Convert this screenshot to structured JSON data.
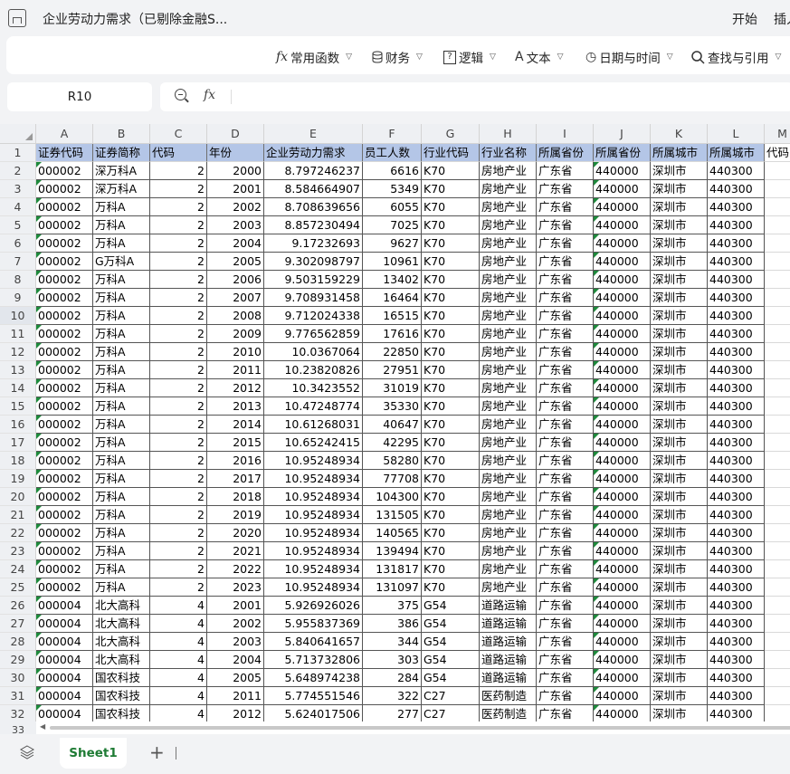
{
  "titlebar": {
    "doc_title": "企业劳动力需求（已剔除金融S...",
    "menu": [
      "开始",
      "插入"
    ]
  },
  "ribbon": {
    "items": [
      {
        "icon": "function-icon",
        "glyph": "fx",
        "label": "常用函数"
      },
      {
        "icon": "database-icon",
        "glyph": "",
        "label": "财务"
      },
      {
        "icon": "logic-icon",
        "glyph": "?",
        "label": "逻辑"
      },
      {
        "icon": "text-icon",
        "glyph": "A",
        "label": "文本"
      },
      {
        "icon": "clock-icon",
        "glyph": "◷",
        "label": "日期与时间"
      },
      {
        "icon": "search-icon",
        "glyph": "",
        "label": "查找与引用"
      }
    ]
  },
  "formula_bar": {
    "cell_ref": "R10",
    "fx": "fx",
    "value": ""
  },
  "sheet": {
    "columns": [
      "A",
      "B",
      "C",
      "D",
      "E",
      "F",
      "G",
      "H",
      "I",
      "J",
      "K",
      "L",
      "M"
    ],
    "headers": [
      "证券代码",
      "证券简称",
      "代码",
      "年份",
      "企业劳动力需求",
      "员工人数",
      "行业代码",
      "行业名称",
      "所属省份",
      "所属省份",
      "所属城市",
      "所属城市",
      "代码"
    ],
    "rows": [
      [
        "000002",
        "深万科A",
        "2",
        "2000",
        "8.797246237",
        "6616",
        "K70",
        "房地产业",
        "广东省",
        "440000",
        "深圳市",
        "440300"
      ],
      [
        "000002",
        "深万科A",
        "2",
        "2001",
        "8.584664907",
        "5349",
        "K70",
        "房地产业",
        "广东省",
        "440000",
        "深圳市",
        "440300"
      ],
      [
        "000002",
        "万科A",
        "2",
        "2002",
        "8.708639656",
        "6055",
        "K70",
        "房地产业",
        "广东省",
        "440000",
        "深圳市",
        "440300"
      ],
      [
        "000002",
        "万科A",
        "2",
        "2003",
        "8.857230494",
        "7025",
        "K70",
        "房地产业",
        "广东省",
        "440000",
        "深圳市",
        "440300"
      ],
      [
        "000002",
        "万科A",
        "2",
        "2004",
        "9.17232693",
        "9627",
        "K70",
        "房地产业",
        "广东省",
        "440000",
        "深圳市",
        "440300"
      ],
      [
        "000002",
        "G万科A",
        "2",
        "2005",
        "9.302098797",
        "10961",
        "K70",
        "房地产业",
        "广东省",
        "440000",
        "深圳市",
        "440300"
      ],
      [
        "000002",
        "万科A",
        "2",
        "2006",
        "9.503159229",
        "13402",
        "K70",
        "房地产业",
        "广东省",
        "440000",
        "深圳市",
        "440300"
      ],
      [
        "000002",
        "万科A",
        "2",
        "2007",
        "9.708931458",
        "16464",
        "K70",
        "房地产业",
        "广东省",
        "440000",
        "深圳市",
        "440300"
      ],
      [
        "000002",
        "万科A",
        "2",
        "2008",
        "9.712024338",
        "16515",
        "K70",
        "房地产业",
        "广东省",
        "440000",
        "深圳市",
        "440300"
      ],
      [
        "000002",
        "万科A",
        "2",
        "2009",
        "9.776562859",
        "17616",
        "K70",
        "房地产业",
        "广东省",
        "440000",
        "深圳市",
        "440300"
      ],
      [
        "000002",
        "万科A",
        "2",
        "2010",
        "10.0367064",
        "22850",
        "K70",
        "房地产业",
        "广东省",
        "440000",
        "深圳市",
        "440300"
      ],
      [
        "000002",
        "万科A",
        "2",
        "2011",
        "10.23820826",
        "27951",
        "K70",
        "房地产业",
        "广东省",
        "440000",
        "深圳市",
        "440300"
      ],
      [
        "000002",
        "万科A",
        "2",
        "2012",
        "10.3423552",
        "31019",
        "K70",
        "房地产业",
        "广东省",
        "440000",
        "深圳市",
        "440300"
      ],
      [
        "000002",
        "万科A",
        "2",
        "2013",
        "10.47248774",
        "35330",
        "K70",
        "房地产业",
        "广东省",
        "440000",
        "深圳市",
        "440300"
      ],
      [
        "000002",
        "万科A",
        "2",
        "2014",
        "10.61268031",
        "40647",
        "K70",
        "房地产业",
        "广东省",
        "440000",
        "深圳市",
        "440300"
      ],
      [
        "000002",
        "万科A",
        "2",
        "2015",
        "10.65242415",
        "42295",
        "K70",
        "房地产业",
        "广东省",
        "440000",
        "深圳市",
        "440300"
      ],
      [
        "000002",
        "万科A",
        "2",
        "2016",
        "10.95248934",
        "58280",
        "K70",
        "房地产业",
        "广东省",
        "440000",
        "深圳市",
        "440300"
      ],
      [
        "000002",
        "万科A",
        "2",
        "2017",
        "10.95248934",
        "77708",
        "K70",
        "房地产业",
        "广东省",
        "440000",
        "深圳市",
        "440300"
      ],
      [
        "000002",
        "万科A",
        "2",
        "2018",
        "10.95248934",
        "104300",
        "K70",
        "房地产业",
        "广东省",
        "440000",
        "深圳市",
        "440300"
      ],
      [
        "000002",
        "万科A",
        "2",
        "2019",
        "10.95248934",
        "131505",
        "K70",
        "房地产业",
        "广东省",
        "440000",
        "深圳市",
        "440300"
      ],
      [
        "000002",
        "万科A",
        "2",
        "2020",
        "10.95248934",
        "140565",
        "K70",
        "房地产业",
        "广东省",
        "440000",
        "深圳市",
        "440300"
      ],
      [
        "000002",
        "万科A",
        "2",
        "2021",
        "10.95248934",
        "139494",
        "K70",
        "房地产业",
        "广东省",
        "440000",
        "深圳市",
        "440300"
      ],
      [
        "000002",
        "万科A",
        "2",
        "2022",
        "10.95248934",
        "131817",
        "K70",
        "房地产业",
        "广东省",
        "440000",
        "深圳市",
        "440300"
      ],
      [
        "000002",
        "万科A",
        "2",
        "2023",
        "10.95248934",
        "131097",
        "K70",
        "房地产业",
        "广东省",
        "440000",
        "深圳市",
        "440300"
      ],
      [
        "000004",
        "北大高科",
        "4",
        "2001",
        "5.926926026",
        "375",
        "G54",
        "道路运输",
        "广东省",
        "440000",
        "深圳市",
        "440300"
      ],
      [
        "000004",
        "北大高科",
        "4",
        "2002",
        "5.955837369",
        "386",
        "G54",
        "道路运输",
        "广东省",
        "440000",
        "深圳市",
        "440300"
      ],
      [
        "000004",
        "北大高科",
        "4",
        "2003",
        "5.840641657",
        "344",
        "G54",
        "道路运输",
        "广东省",
        "440000",
        "深圳市",
        "440300"
      ],
      [
        "000004",
        "北大高科",
        "4",
        "2004",
        "5.713732806",
        "303",
        "G54",
        "道路运输",
        "广东省",
        "440000",
        "深圳市",
        "440300"
      ],
      [
        "000004",
        "国农科技",
        "4",
        "2005",
        "5.648974238",
        "284",
        "G54",
        "道路运输",
        "广东省",
        "440000",
        "深圳市",
        "440300"
      ],
      [
        "000004",
        "国农科技",
        "4",
        "2011",
        "5.774551546",
        "322",
        "C27",
        "医药制造",
        "广东省",
        "440000",
        "深圳市",
        "440300"
      ],
      [
        "000004",
        "国农科技",
        "4",
        "2012",
        "5.624017506",
        "277",
        "C27",
        "医药制造",
        "广东省",
        "440000",
        "深圳市",
        "440300"
      ]
    ],
    "partial_row_number": "33",
    "selected_row": "10"
  },
  "tabs": {
    "sheets": [
      "Sheet1"
    ],
    "add": "+"
  },
  "colors": {
    "header_fill": "#b4c6e7",
    "tab_text": "#1e7b34",
    "error_marker": "#1e8a3c"
  }
}
